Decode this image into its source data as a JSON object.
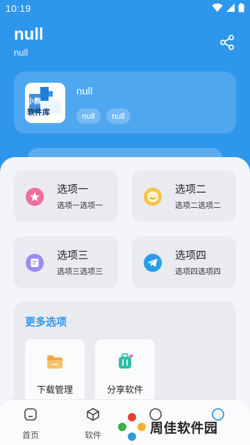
{
  "status_bar": {
    "time": "10:19"
  },
  "header": {
    "title": "null",
    "subtitle": "null"
  },
  "profile": {
    "name": "null",
    "tags": [
      "null",
      "null"
    ],
    "logo_text_top": "小熊",
    "logo_text_main": "软件库"
  },
  "options": [
    {
      "title": "选项一",
      "subtitle": "选项一选项一",
      "icon": "star-icon",
      "color": "#f36d9a"
    },
    {
      "title": "选项二",
      "subtitle": "选项二选项二",
      "icon": "smile-icon",
      "color": "#f6c44a"
    },
    {
      "title": "选项三",
      "subtitle": "选项三选项三",
      "icon": "note-icon",
      "color": "#9b8cf5"
    },
    {
      "title": "选项四",
      "subtitle": "选项四选项四",
      "icon": "telegram-icon",
      "color": "#2a9de6"
    }
  ],
  "more_section": {
    "title": "更多选项",
    "items": [
      {
        "label": "下载管理",
        "icon": "folder-icon"
      },
      {
        "label": "分享软件",
        "icon": "suitcase-icon"
      }
    ]
  },
  "bottom_nav": {
    "items": [
      {
        "label": "首页",
        "icon": "home-icon"
      },
      {
        "label": "软件",
        "icon": "box-icon"
      }
    ]
  },
  "watermark": {
    "text": "周佳软件园"
  },
  "colors": {
    "primary": "#2e97ec",
    "background": "#f3f5f9",
    "tile": "#e9ebf0"
  }
}
